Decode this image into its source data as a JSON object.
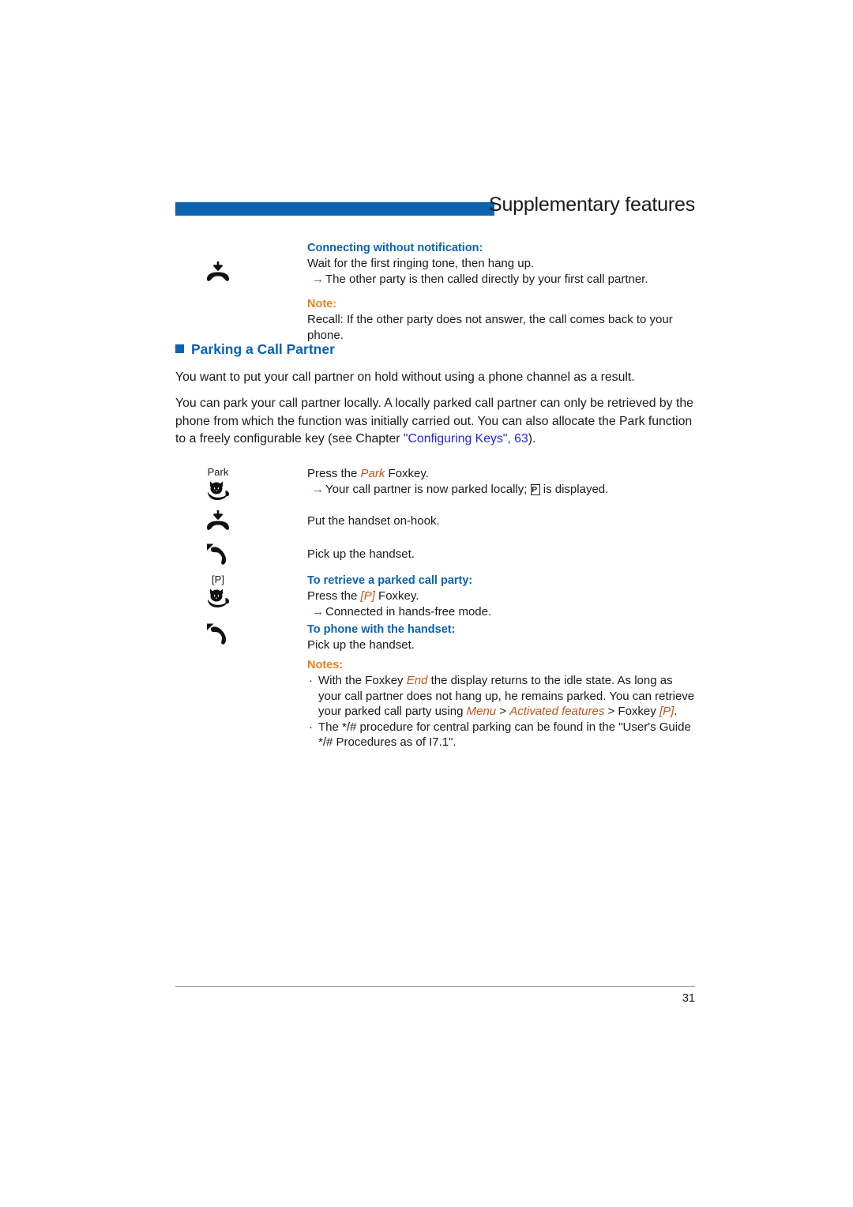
{
  "header": {
    "title": "Supplementary features",
    "bar_color": "#0b62b0"
  },
  "colors": {
    "brand_blue": "#0b62b0",
    "note_orange": "#e8821e",
    "emphasis_orange": "#c2541a",
    "xref_blue": "#2323dd"
  },
  "intro_block": {
    "icon_name": "handset-on-hook-icon",
    "heading": "Connecting without notification:",
    "line1": "Wait for the first ringing tone, then hang up.",
    "arrow_line": "The other party is then called directly by your first call partner.",
    "note_label": "Note:",
    "note_text": "Recall: If the other party does not answer, the call comes back to your phone."
  },
  "section": {
    "heading": "Parking a Call Partner",
    "paragraph1": "You want to put your call partner on hold without using a phone channel as a result.",
    "paragraph2_a": "You can park your call partner locally. A locally parked call partner can only be retrieved by the phone from which the function was initially carried out. You can also allocate the Park function to a freely configurable key (see Chapter ",
    "paragraph2_xref": "\"Configuring Keys\", 63",
    "paragraph2_b": ")."
  },
  "steps": [
    {
      "key_caption": "Park",
      "icon_name": "foxkey-fox-icon",
      "text_prefix": "Press the ",
      "text_em": "Park",
      "text_suffix": " Foxkey.",
      "arrow_prefix": "Your call partner is now parked locally; ",
      "arrow_glyph": "P",
      "arrow_suffix": " is displayed."
    },
    {
      "key_caption": "",
      "icon_name": "handset-on-hook-icon",
      "text": "Put the handset on-hook."
    },
    {
      "key_caption": "",
      "icon_name": "handset-pickup-icon",
      "text": "Pick up the handset."
    },
    {
      "key_caption": "[P]",
      "icon_name": "foxkey-fox-icon",
      "heading": "To retrieve a parked call party:",
      "text_prefix": "Press the ",
      "text_em": "[P]",
      "text_suffix": " Foxkey.",
      "arrow_line": "Connected in hands-free mode."
    },
    {
      "key_caption": "",
      "icon_name": "handset-pickup-icon",
      "heading": "To phone with the handset:",
      "text": "Pick up the handset."
    }
  ],
  "notes": {
    "label": "Notes:",
    "items": [
      {
        "seg1": "With the Foxkey ",
        "em1": "End",
        "seg2": " the display returns to the idle state. As long as your call partner does not hang up, he remains parked. You can retrieve your parked call party using ",
        "em2": "Menu",
        "seg3": " > ",
        "em3": "Activated features",
        "seg4": " > Foxkey ",
        "em4": "[P]",
        "seg5": "."
      },
      {
        "seg1": "The */# procedure for central parking can be found in the \"User's Guide */# Procedures as of I7.1\"."
      }
    ]
  },
  "footer": {
    "page_number": "31"
  }
}
